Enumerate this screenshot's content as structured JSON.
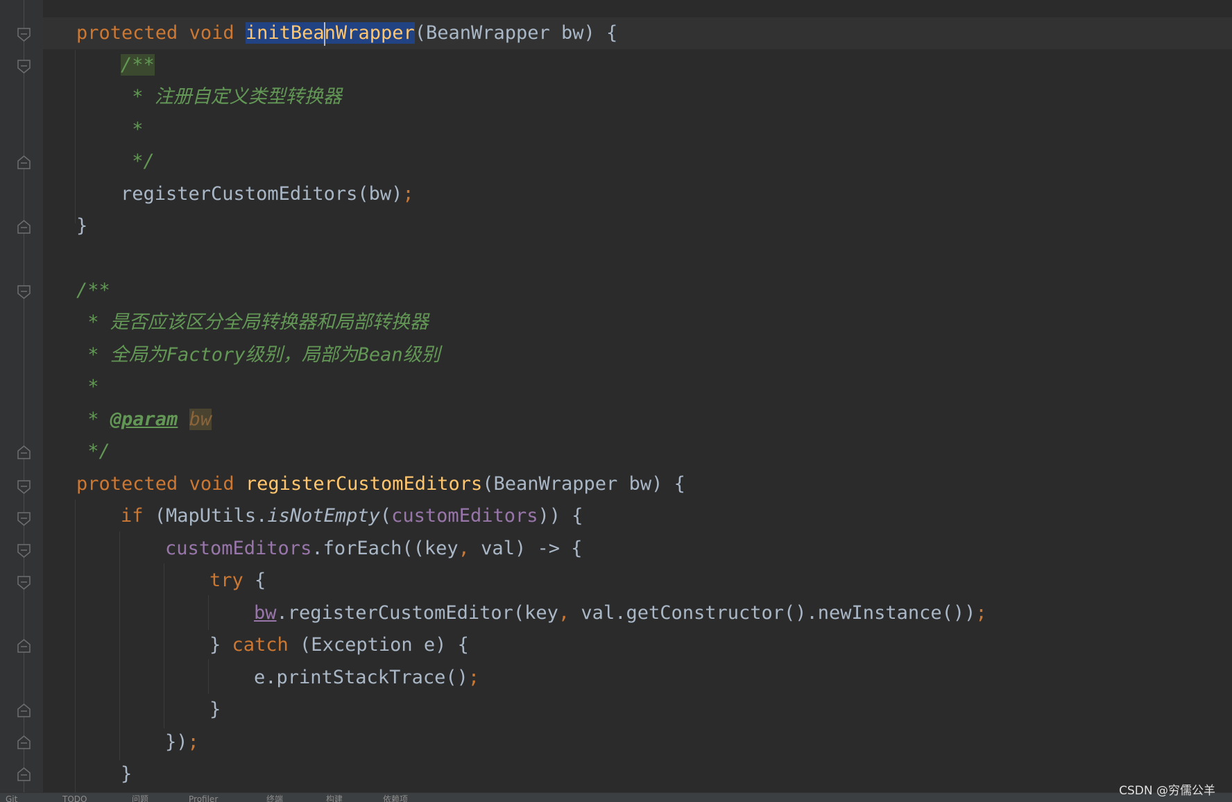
{
  "editor": {
    "selected_identifier": "initBeanWrapper",
    "caret_after": "initBea",
    "lines": {
      "l1": {
        "kw1": "protected",
        "kw2": "void",
        "sel_a": "initBea",
        "sel_b": "nWrapper",
        "rest": "(BeanWrapper bw) {"
      },
      "l2": {
        "doc": "/**"
      },
      "l3": {
        "star": " * ",
        "text": "注册自定义类型转换器"
      },
      "l4": {
        "doc": " *"
      },
      "l5": {
        "doc": " */"
      },
      "l6": {
        "call": "registerCustomEditors(bw)",
        "semi": ";"
      },
      "l7": {
        "text": "}"
      },
      "l9": {
        "doc": "/**"
      },
      "l10": {
        "star": " * ",
        "text": "是否应该区分全局转换器和局部转换器"
      },
      "l11": {
        "star": " * ",
        "a": "全局为",
        "b": "Factory",
        "c": "级别，局部为",
        "d": "Bean",
        "e": "级别"
      },
      "l12": {
        "doc": " *"
      },
      "l13": {
        "star": " * ",
        "tag": "@param",
        "param": "bw"
      },
      "l14": {
        "doc": " */"
      },
      "l15": {
        "kw1": "protected",
        "kw2": "void",
        "fn": "registerCustomEditors",
        "rest": "(BeanWrapper bw) {"
      },
      "l16": {
        "kw": "if",
        "a": " (MapUtils.",
        "static": "isNotEmpty",
        "b": "(",
        "field": "customEditors",
        "c": ")) {"
      },
      "l17": {
        "field": "customEditors",
        "a": ".forEach((key",
        "comma": ",",
        "b": " val) -> {"
      },
      "l18": {
        "kw": "try",
        "a": " {"
      },
      "l19": {
        "var": "bw",
        "a": ".registerCustomEditor(key",
        "comma": ",",
        "b": " val.getConstructor().newInstance())",
        "semi": ";"
      },
      "l20": {
        "a": "} ",
        "kw": "catch",
        "b": " (Exception e) {"
      },
      "l21": {
        "a": "e.printStackTrace()",
        "semi": ";"
      },
      "l22": {
        "a": "}"
      },
      "l23": {
        "a": "})",
        "semi": ";"
      },
      "l24": {
        "a": "}"
      }
    }
  },
  "status_bar": {
    "items": [
      "Git",
      "TODO",
      "问题",
      "Profiler",
      "终端",
      "构建",
      "依赖项"
    ]
  },
  "watermark": "CSDN @穷儒公羊"
}
